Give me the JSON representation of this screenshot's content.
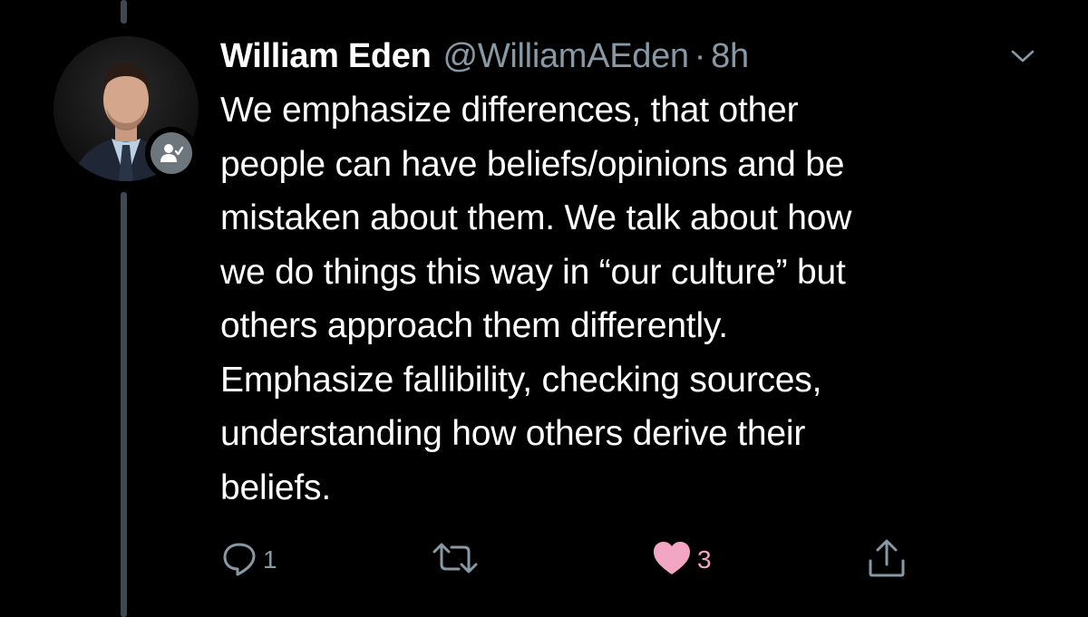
{
  "tweet": {
    "display_name": "William Eden",
    "handle": "@WilliamAEden",
    "separator": "·",
    "time": "8h",
    "text_lines": [
      "We emphasize differences, that other",
      "people can have beliefs/opinions and be",
      "mistaken about them. We talk about how",
      "we do things this way in “our culture” but",
      "others approach them differently.",
      "Emphasize fallibility, checking sources,",
      "understanding how others derive their",
      "beliefs."
    ]
  },
  "actions": {
    "reply_count": "1",
    "retweet_count": "",
    "like_count": "3"
  },
  "icons": {
    "reply": "reply-icon",
    "retweet": "retweet-icon",
    "like": "heart-icon",
    "share": "share-icon",
    "more": "chevron-down-icon",
    "follow_badge": "follow-person-icon"
  },
  "colors": {
    "background": "#000000",
    "secondary_text": "#8899a6",
    "like_active": "#f3a6c3",
    "thread_line": "#3d4a54"
  }
}
